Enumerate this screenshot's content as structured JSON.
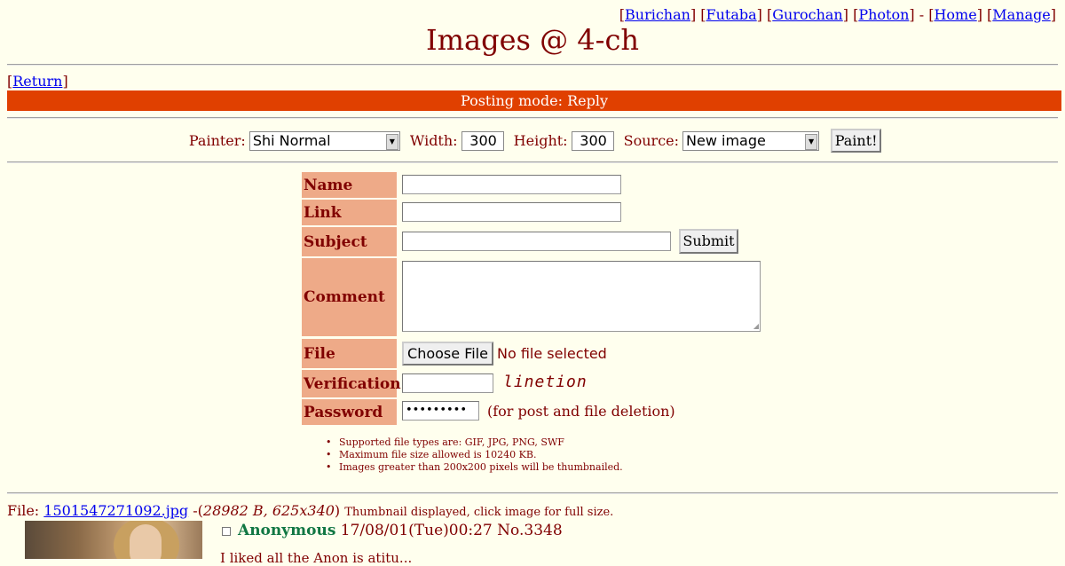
{
  "nav": {
    "boards": [
      "Burichan",
      "Futaba",
      "Gurochan",
      "Photon"
    ],
    "sep": "-",
    "home": "Home",
    "manage": "Manage"
  },
  "title": "Images @ 4-ch",
  "return_link": "Return",
  "mode": "Posting mode: Reply",
  "painter": {
    "painter_label": "Painter:",
    "painter_value": "Shi Normal",
    "width_label": "Width:",
    "width_value": "300",
    "height_label": "Height:",
    "height_value": "300",
    "source_label": "Source:",
    "source_value": "New image",
    "paint_button": "Paint!"
  },
  "form": {
    "name_label": "Name",
    "link_label": "Link",
    "subject_label": "Subject",
    "submit_button": "Submit",
    "comment_label": "Comment",
    "file_label": "File",
    "choose_file_button": "Choose File",
    "no_file_text": "No file selected",
    "verification_label": "Verification",
    "captcha_text": "linetion",
    "password_label": "Password",
    "password_value": "•••••••••",
    "password_note": "(for post and file deletion)"
  },
  "rules": [
    "Supported file types are: GIF, JPG, PNG, SWF",
    "Maximum file size allowed is 10240 KB.",
    "Images greater than 200x200 pixels will be thumbnailed."
  ],
  "post": {
    "file_prefix": "File:",
    "filename": "1501547271092.jpg",
    "file_meta": "28982 B, 625x340",
    "thumb_note": "Thumbnail displayed, click image for full size.",
    "name": "Anonymous",
    "date": "17/08/01(Tue)00:27",
    "number": "No.3348",
    "comment_cut": "I liked all the Anon is atitu..."
  },
  "colors": {
    "background": "#FFFFEE",
    "text": "#800000",
    "mode_bar": "#E04000",
    "label_bg": "#EEAA88",
    "poster_name": "#117743",
    "link": "#0000EE"
  }
}
